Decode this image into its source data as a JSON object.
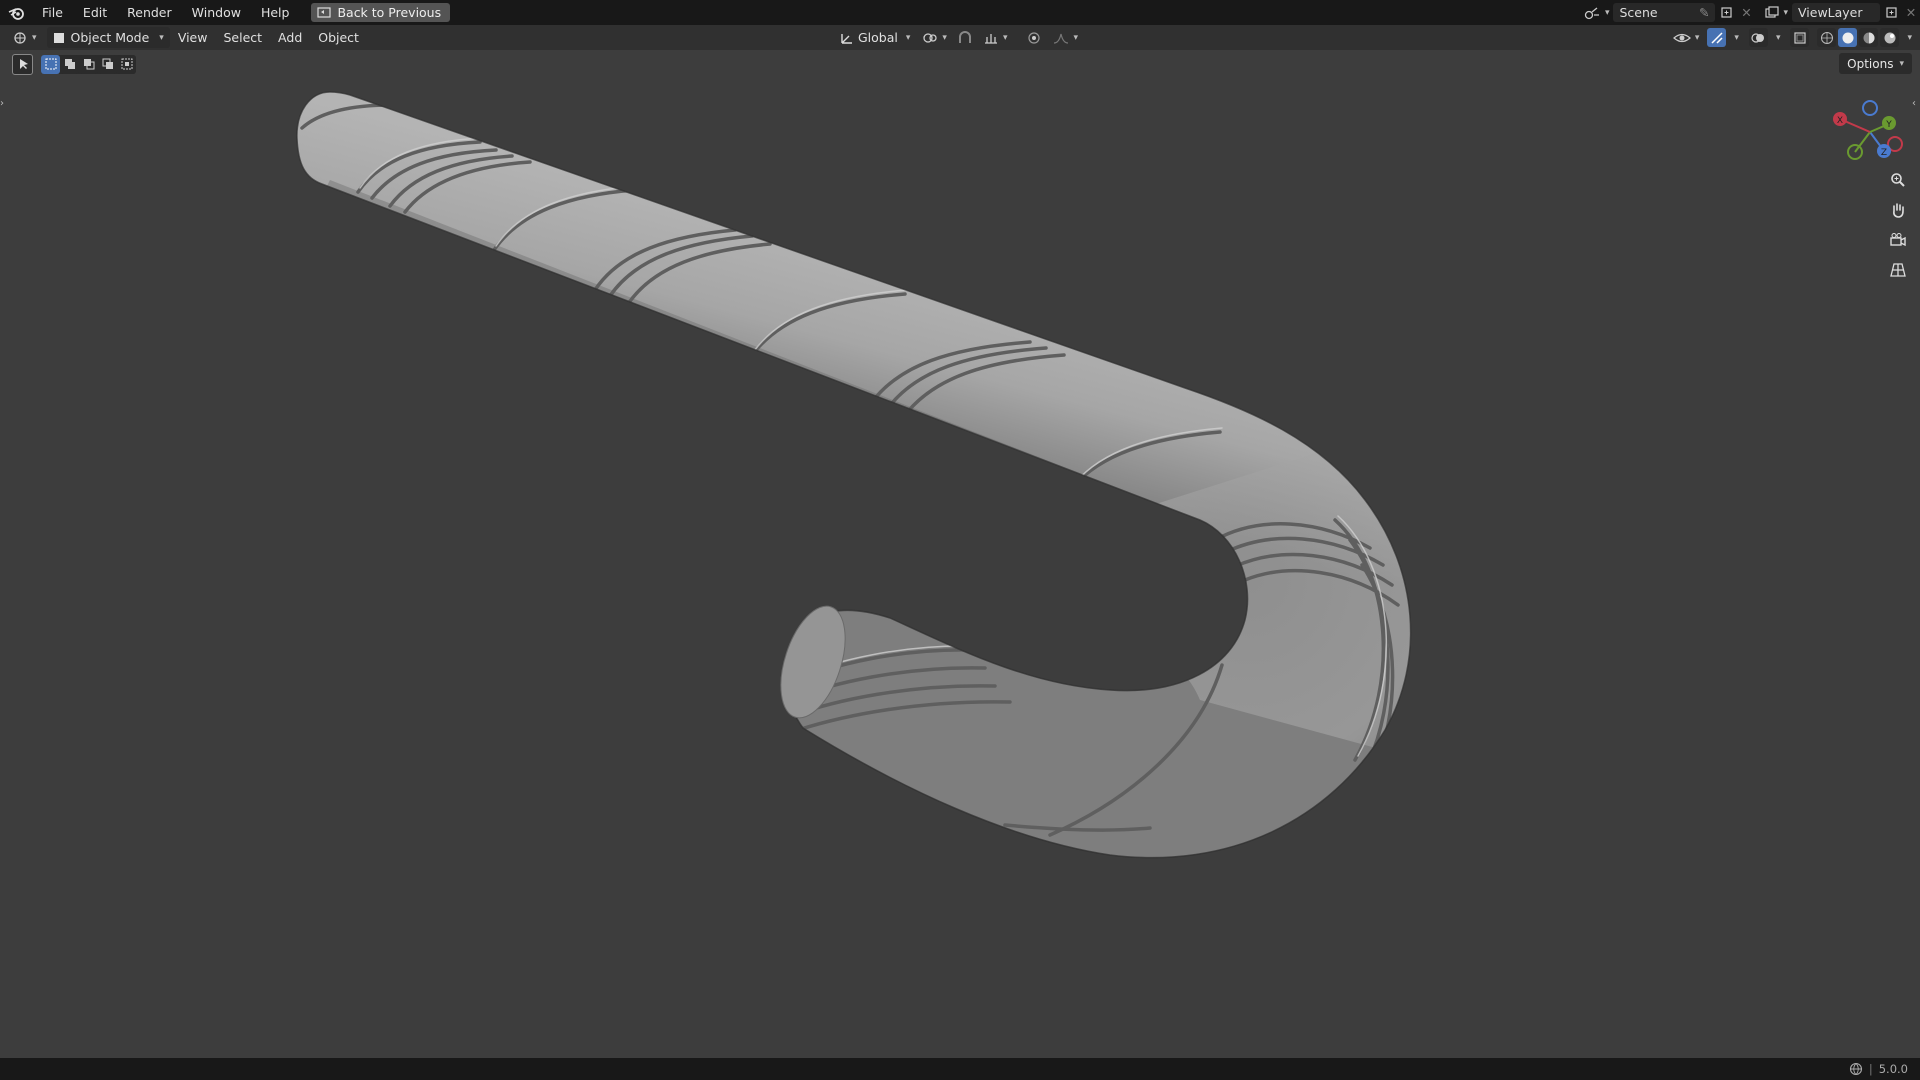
{
  "app": {
    "menus": [
      "File",
      "Edit",
      "Render",
      "Window",
      "Help"
    ],
    "back_button": "Back to Previous",
    "scene_name": "Scene",
    "view_layer": "ViewLayer"
  },
  "header": {
    "mode": "Object Mode",
    "menus": [
      "View",
      "Select",
      "Add",
      "Object"
    ],
    "transform_orientation": "Global",
    "options_label": "Options"
  },
  "viewport": {
    "object": "candy-cane",
    "colors": {
      "background": "#3d3d3d",
      "mesh": "#a6a6a6",
      "accent": "#4772b3"
    },
    "gizmo_axes": [
      "X",
      "Y",
      "Z"
    ]
  },
  "status": {
    "version": "5.0.0"
  }
}
